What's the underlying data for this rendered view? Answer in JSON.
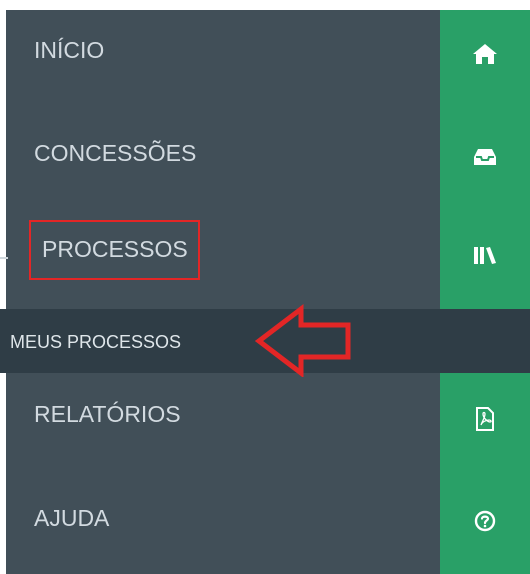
{
  "menu": {
    "items": [
      {
        "label": "INÍCIO",
        "icon": "home-icon"
      },
      {
        "label": "CONCESSÕES",
        "icon": "inbox-icon"
      },
      {
        "label": "PROCESSOS",
        "icon": "books-icon"
      },
      {
        "label": "RELATÓRIOS",
        "icon": "file-pdf-icon"
      },
      {
        "label": "AJUDA",
        "icon": "question-circle-icon"
      }
    ],
    "submenu": {
      "label": "MEUS PROCESSOS"
    }
  },
  "colors": {
    "menu_bg": "#414f58",
    "submenu_bg": "#2f3d46",
    "rail_bg": "#29a067",
    "annotation": "#e32626"
  }
}
